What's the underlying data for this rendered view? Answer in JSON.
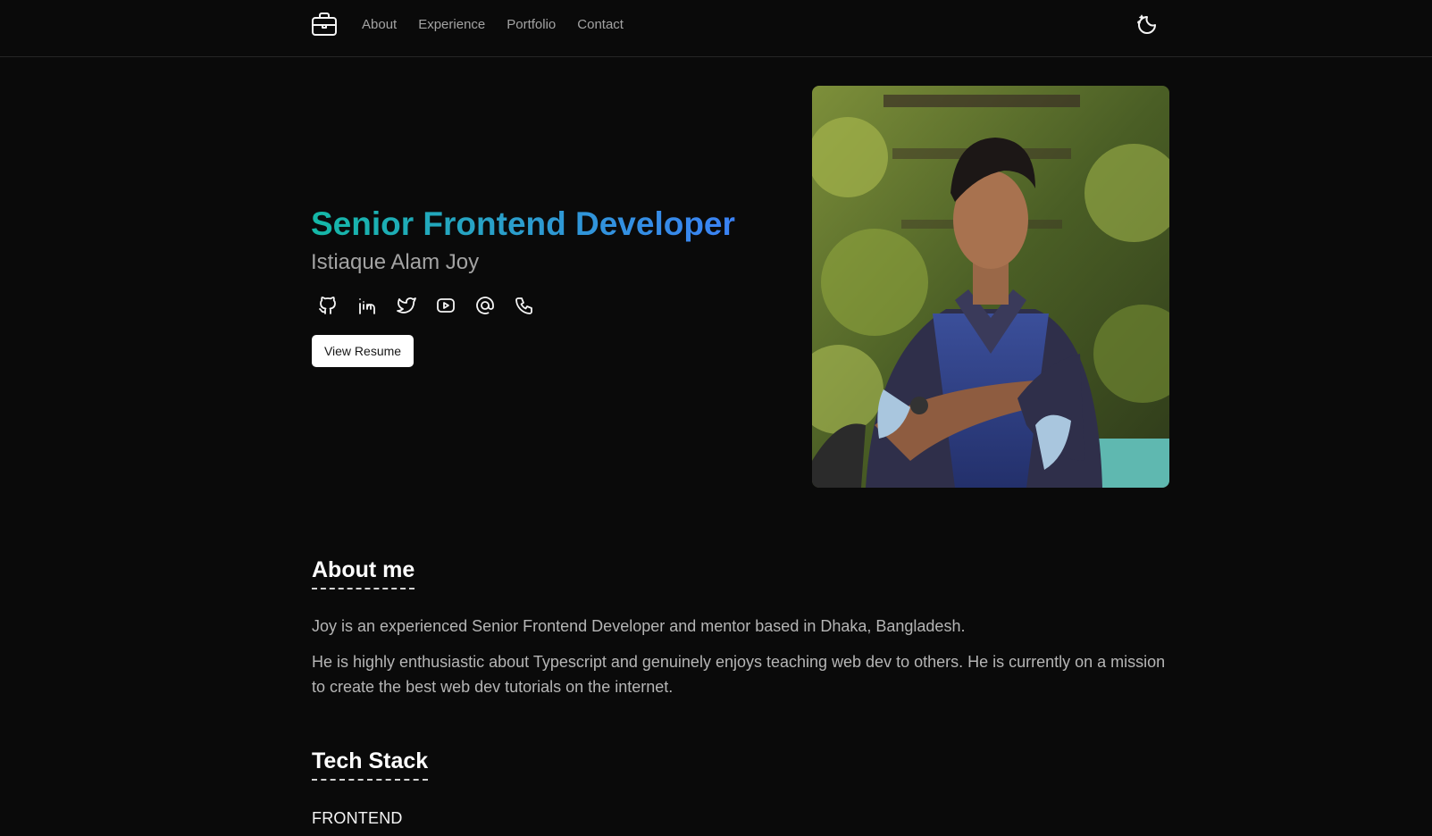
{
  "nav": {
    "items": [
      "About",
      "Experience",
      "Portfolio",
      "Contact"
    ]
  },
  "hero": {
    "title": "Senior Frontend Developer",
    "name": "Istiaque Alam Joy",
    "resume_button": "View Resume",
    "socials": [
      "github-icon",
      "linkedin-icon",
      "twitter-icon",
      "youtube-icon",
      "at-sign-icon",
      "phone-icon"
    ]
  },
  "about": {
    "heading": "About me",
    "paragraphs": [
      "Joy is an experienced Senior Frontend Developer and mentor based in Dhaka, Bangladesh.",
      "He is highly enthusiastic about Typescript and genuinely enjoys teaching web dev to others. He is currently on a mission to create the best web dev tutorials on the internet."
    ]
  },
  "tech": {
    "heading": "Tech Stack",
    "frontend_label": "FRONTEND"
  },
  "colors": {
    "background": "#0a0a0a",
    "gradient_start": "#14b8a6",
    "gradient_end": "#3b82f6",
    "muted_text": "#a3a3a3"
  }
}
